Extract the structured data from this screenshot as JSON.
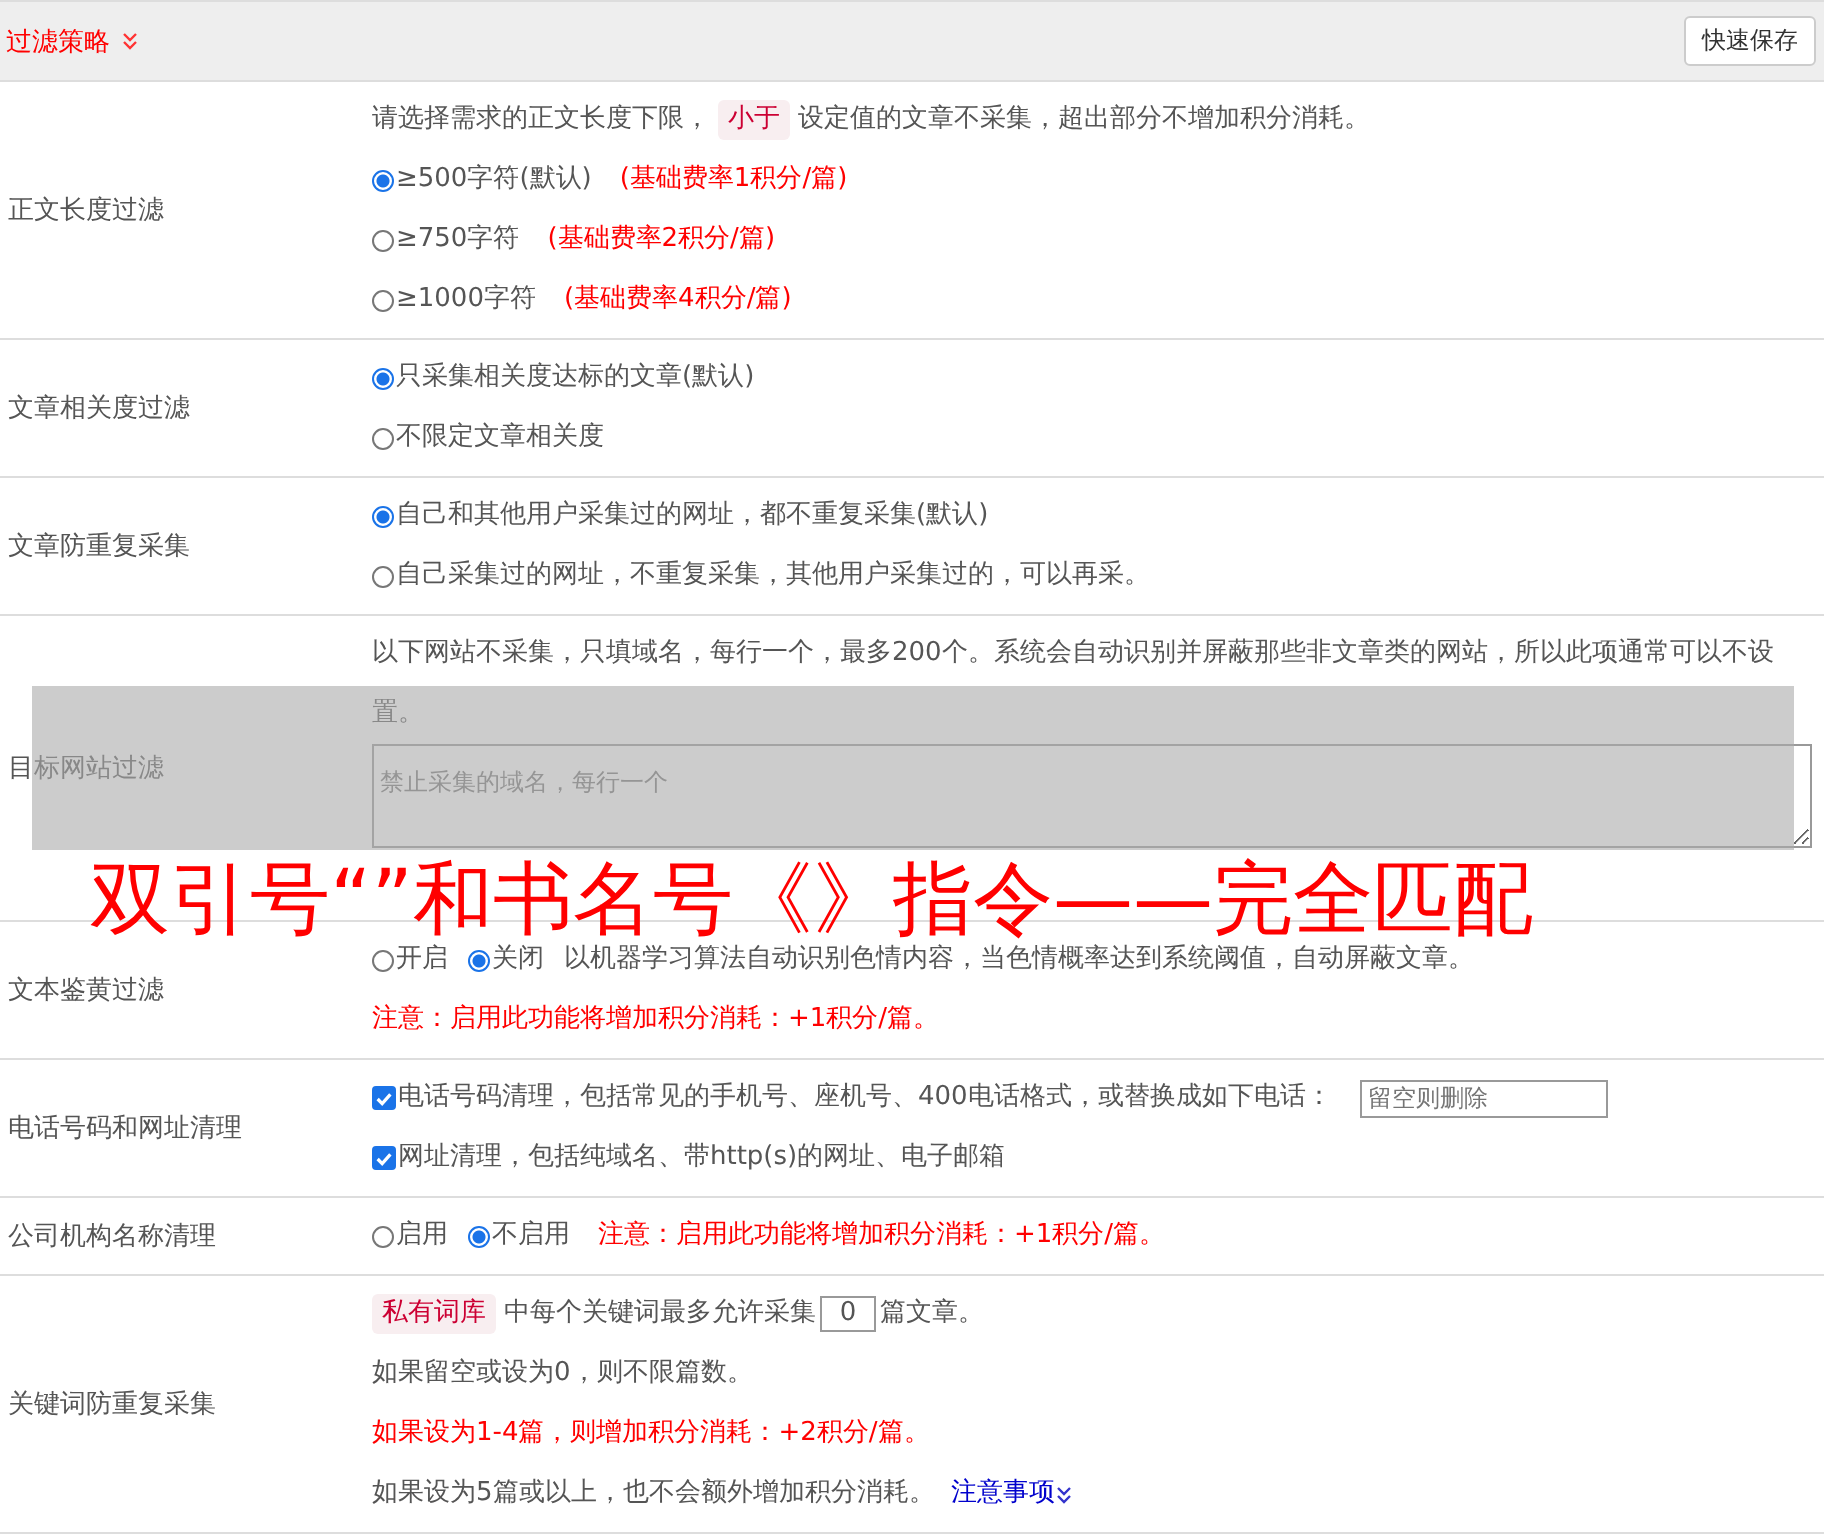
{
  "header": {
    "title": "过滤策略",
    "save_button": "快速保存"
  },
  "rows": [
    {
      "label": "正文长度过滤",
      "lines": [
        [
          {
            "kind": "text",
            "text": "请选择需求的正文长度下限，"
          },
          {
            "kind": "tag",
            "text": "小于"
          },
          {
            "kind": "text",
            "text": "设定值的文章不采集，超出部分不增加积分消耗。"
          }
        ],
        [
          {
            "kind": "radio",
            "text": "≥500字符(默认)",
            "selected": true
          },
          {
            "kind": "note",
            "text": "(基础费率1积分/篇)"
          }
        ],
        [
          {
            "kind": "radio",
            "text": "≥750字符",
            "selected": false
          },
          {
            "kind": "note",
            "text": "(基础费率2积分/篇)"
          }
        ],
        [
          {
            "kind": "radio",
            "text": "≥1000字符",
            "selected": false
          },
          {
            "kind": "note",
            "text": "(基础费率4积分/篇)"
          }
        ]
      ]
    },
    {
      "label": "文章相关度过滤",
      "lines": [
        [
          {
            "kind": "radio",
            "text": "只采集相关度达标的文章(默认)",
            "selected": true
          }
        ],
        [
          {
            "kind": "radio",
            "text": "不限定文章相关度",
            "selected": false
          }
        ]
      ]
    },
    {
      "label": "文章防重复采集",
      "lines": [
        [
          {
            "kind": "radio",
            "text": "自己和其他用户采集过的网址，都不重复采集(默认)",
            "selected": true
          }
        ],
        [
          {
            "kind": "radio",
            "text": "自己采集过的网址，不重复采集，其他用户采集过的，可以再采。",
            "selected": false
          }
        ]
      ]
    },
    {
      "label": "目标网站过滤",
      "lines": [
        [
          {
            "kind": "text",
            "text": "以下网站不采集，只填域名，每行一个，最多200个。系统会自动识别并屏蔽那些非文章类的网站，所以此项通常可以不设置。"
          }
        ],
        [
          {
            "kind": "textarea",
            "placeholder": "禁止采集的域名，每行一个"
          }
        ]
      ]
    },
    {
      "label": "文本鉴黄过滤",
      "lines": [
        [
          {
            "kind": "radio",
            "text": "开启",
            "selected": false
          },
          {
            "kind": "radio",
            "text": "关闭",
            "selected": true
          },
          {
            "kind": "text",
            "text": "以机器学习算法自动识别色情内容，当色情概率达到系统阈值，自动屏蔽文章。"
          }
        ],
        [
          {
            "kind": "note",
            "text": "注意：启用此功能将增加积分消耗：+1积分/篇。"
          }
        ]
      ]
    },
    {
      "label": "电话号码和网址清理",
      "lines": [
        [
          {
            "kind": "checkbox",
            "text": "电话号码清理，包括常见的手机号、座机号、400电话格式，或替换成如下电话：",
            "checked": true
          },
          {
            "kind": "input",
            "placeholder": "留空则删除"
          }
        ],
        [
          {
            "kind": "checkbox",
            "text": "网址清理，包括纯域名、带http(s)的网址、电子邮箱",
            "checked": true
          }
        ]
      ]
    },
    {
      "label": "公司机构名称清理",
      "lines": [
        [
          {
            "kind": "radio",
            "text": "启用",
            "selected": false
          },
          {
            "kind": "radio",
            "text": "不启用",
            "selected": true
          },
          {
            "kind": "note",
            "text": "注意：启用此功能将增加积分消耗：+1积分/篇。"
          }
        ]
      ]
    },
    {
      "label": "关键词防重复采集",
      "lines": [
        [
          {
            "kind": "tag",
            "text": "私有词库"
          },
          {
            "kind": "text",
            "text": "中每个关键词最多允许采集"
          },
          {
            "kind": "number",
            "value": "0"
          },
          {
            "kind": "text",
            "text": "篇文章。"
          }
        ],
        [
          {
            "kind": "text",
            "text": "如果留空或设为0，则不限篇数。"
          }
        ],
        [
          {
            "kind": "note",
            "text": "如果设为1-4篇，则增加积分消耗：+2积分/篇。"
          }
        ],
        [
          {
            "kind": "text",
            "text": "如果设为5篇或以上，也不会额外增加积分消耗。"
          },
          {
            "kind": "link",
            "text": "注意事项"
          }
        ]
      ]
    }
  ],
  "overlay": {
    "caption": "双引号“”和书名号《》指令——完全匹配"
  }
}
